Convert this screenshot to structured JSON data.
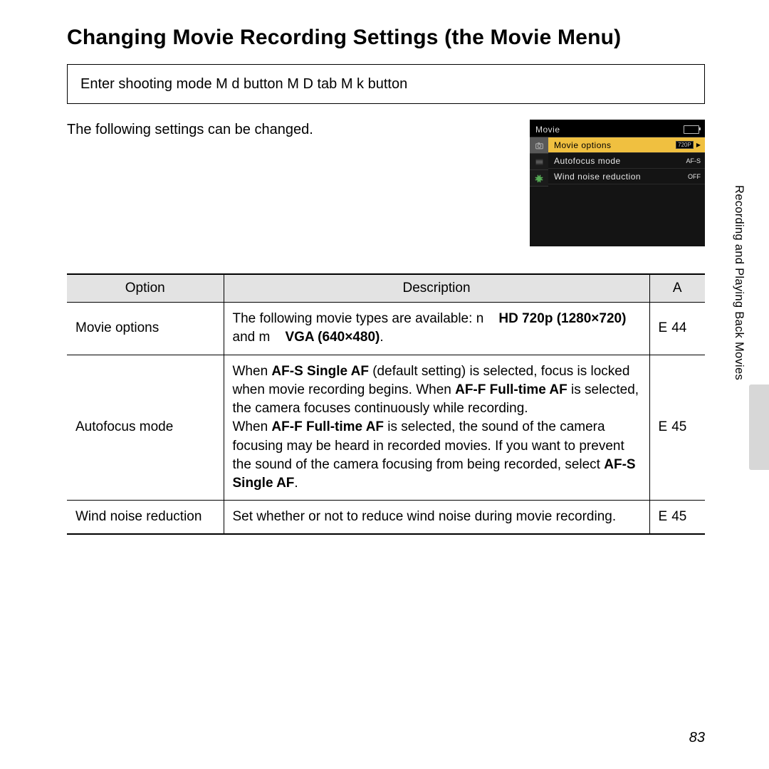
{
  "title": "Changing Movie Recording Settings (the Movie Menu)",
  "path": {
    "seg1": "Enter shooting mode ",
    "arrow1": "M",
    "seg2": " d ",
    "seg3": "    button ",
    "arrow2": "M",
    "seg4": " D ",
    "seg5": " tab ",
    "arrow3": "M",
    "seg6": " k ",
    "seg7": "  button"
  },
  "intro": "The following settings can be changed.",
  "camera_menu": {
    "title": "Movie",
    "rows": [
      {
        "label": "Movie options",
        "value": "720P",
        "selected": true,
        "has_caret": true
      },
      {
        "label": "Autofocus mode",
        "value": "AF-S",
        "selected": false,
        "has_caret": false
      },
      {
        "label": "Wind noise reduction",
        "value": "OFF",
        "selected": false,
        "has_caret": false
      }
    ]
  },
  "side_label": "Recording and Playing Back Movies",
  "table": {
    "headers": {
      "option": "Option",
      "description": "Description",
      "ref": "A"
    },
    "rows": [
      {
        "option": "Movie options",
        "desc_html": "The following movie types are available: <span class='sym'>n</span>&nbsp;&nbsp;&nbsp; <b>HD 720p (1280×720)</b> and <span class='sym'>m</span>&nbsp;&nbsp;&nbsp; <b>VGA (640×480)</b>.",
        "ref_sym": "E",
        "ref_pg": "44"
      },
      {
        "option": "Autofocus mode",
        "desc_html": "When <b>AF-S Single AF</b> (default setting) is selected, focus is locked when movie recording begins. When <b>AF-F Full-time AF</b> is selected, the camera focuses continuously while recording.<br>When <b>AF-F Full-time AF</b> is selected, the sound of the camera focusing may be heard in recorded movies. If you want to prevent the sound of the camera focusing from being recorded, select <b>AF-S Single AF</b>.",
        "ref_sym": "E",
        "ref_pg": "45"
      },
      {
        "option": "Wind noise reduction",
        "desc_html": "Set whether or not to reduce wind noise during movie recording.",
        "ref_sym": "E",
        "ref_pg": "45"
      }
    ]
  },
  "page_number": "83"
}
